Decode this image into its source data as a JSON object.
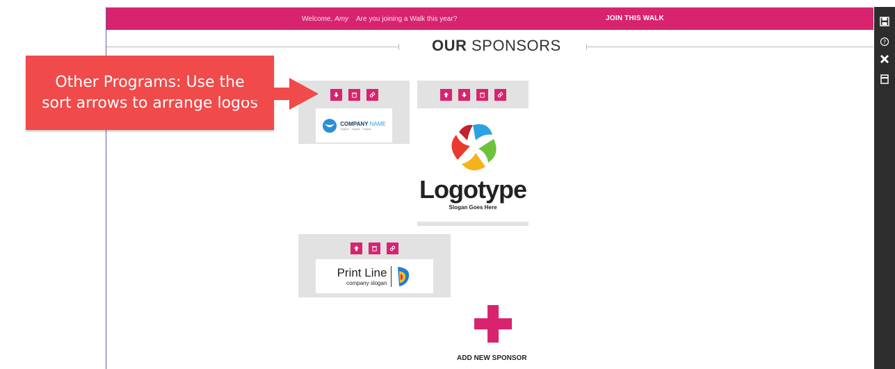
{
  "topbar": {
    "welcome_prefix": "Welcome,",
    "user_name": "Amy",
    "question": "Are you joining a Walk this year?",
    "join_label": "JOIN THIS WALK"
  },
  "heading": {
    "bold": "OUR",
    "rest": " SPONSORS"
  },
  "sponsors": [
    {
      "controls": [
        "down-arrow",
        "trash",
        "link"
      ],
      "logo_text_primary": "COMPANY",
      "logo_text_secondary": "NAME",
      "logo_subtext": "Tagline · Tagline · Tagline"
    },
    {
      "controls": [
        "up-arrow",
        "down-arrow",
        "trash",
        "link"
      ],
      "logo_word": "Logotype",
      "logo_slogan": "Slogan Goes Here"
    },
    {
      "controls": [
        "up-arrow",
        "trash",
        "link"
      ],
      "logo_name": "Print Line",
      "logo_slogan": "company slogan"
    }
  ],
  "add_sponsor_label": "ADD NEW SPONSOR",
  "callout": {
    "line1": "Other Programs: Use the",
    "line2": "sort arrows to arrange logos"
  },
  "sidebar_icons": [
    "save-icon",
    "help-icon",
    "close-icon",
    "archive-icon"
  ],
  "colors": {
    "accent": "#d8236e",
    "callout": "#f04a4a",
    "sidebar": "#2d2d2d",
    "tile": "#e2e2e2"
  }
}
